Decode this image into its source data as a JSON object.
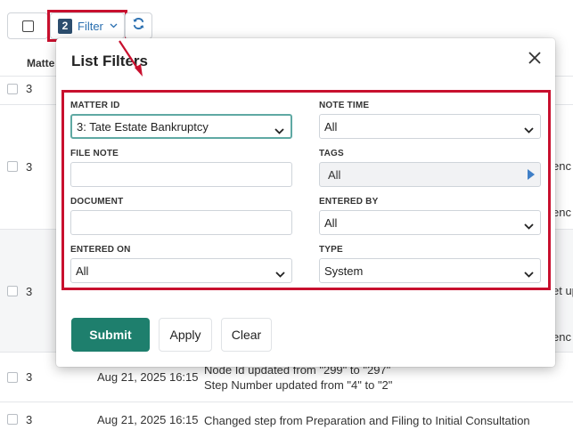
{
  "toolbar": {
    "filter_count": "2",
    "filter_label": "Filter",
    "filter_chevron": "chevron-down-icon",
    "refresh_icon": "refresh-icon"
  },
  "table": {
    "header_matter": "Matte",
    "rows": [
      {
        "id": "3",
        "date": "",
        "desc": [],
        "clip": ""
      },
      {
        "id": "3",
        "date": "",
        "desc": [],
        "clip_1": "enc",
        "clip_2": "enc"
      },
      {
        "id": "3",
        "date": "",
        "desc": [],
        "clip_1": "et up",
        "clip_2": "enc"
      },
      {
        "id": "3",
        "date": "Aug 21, 2025 16:15",
        "desc": [
          "Node Id updated from \"299\" to \"297\"",
          "Step Number updated from \"4\" to \"2\""
        ]
      },
      {
        "id": "3",
        "date": "Aug 21, 2025 16:15",
        "desc": [
          "Changed step from Preparation and Filing to Initial Consultation"
        ]
      }
    ]
  },
  "modal": {
    "title": "List Filters",
    "close_icon": "close-icon",
    "fields": {
      "matter_id": {
        "label": "MATTER ID",
        "value": "3: Tate Estate Bankruptcy"
      },
      "note_time": {
        "label": "NOTE TIME",
        "value": "All"
      },
      "file_note": {
        "label": "FILE NOTE",
        "value": ""
      },
      "tags": {
        "label": "TAGS",
        "value": "All"
      },
      "document": {
        "label": "DOCUMENT",
        "value": ""
      },
      "entered_by": {
        "label": "ENTERED BY",
        "value": "All"
      },
      "entered_on": {
        "label": "ENTERED ON",
        "value": "All"
      },
      "type": {
        "label": "TYPE",
        "value": "System"
      }
    },
    "buttons": {
      "submit": "Submit",
      "apply": "Apply",
      "clear": "Clear"
    }
  },
  "colors": {
    "primary": "#1e7f6d",
    "annotation": "#c8102e",
    "link": "#2a6fb0",
    "badge": "#2c4d6e"
  }
}
